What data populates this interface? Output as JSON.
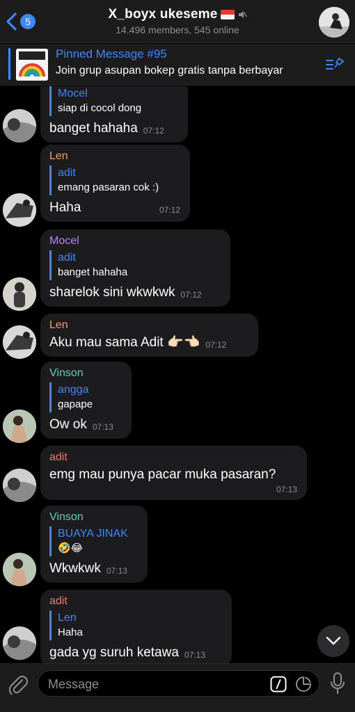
{
  "header": {
    "back_badge": "5",
    "title": "X_boyx ukeseme",
    "subtitle": "14.496 members, 545 online"
  },
  "pinned": {
    "title": "Pinned Message #95",
    "text": "Join grup asupan bokep gratis tanpa berbayar"
  },
  "messages": [
    {
      "sender": "",
      "reply_name": "Mocel",
      "reply_text": "siap di cocol dong",
      "text": "banget hahaha",
      "time": "07:12"
    },
    {
      "sender": "Len",
      "reply_name": "adit",
      "reply_text": "emang pasaran cok :)",
      "text": "Haha",
      "time": "07:12"
    },
    {
      "sender": "Mocel",
      "reply_name": "adit",
      "reply_text": "banget hahaha",
      "text": "sharelok sini wkwkwk",
      "time": "07:12"
    },
    {
      "sender": "Len",
      "text": "Aku mau sama Adit 👉🏻👈🏻",
      "time": "07:12"
    },
    {
      "sender": "Vinson",
      "reply_name": "angga",
      "reply_text": "gapape",
      "text": "Ow ok",
      "time": "07:13"
    },
    {
      "sender": "adit",
      "text": "emg mau punya pacar muka pasaran?",
      "time": "07:13"
    },
    {
      "sender": "Vinson",
      "reply_name": "BUAYA JINAK",
      "reply_text": "🤣😂",
      "text": "Wkwkwk",
      "time": "07:13"
    },
    {
      "sender": "adit",
      "reply_name": "Len",
      "reply_text": "Haha",
      "text": "gada yg suruh ketawa",
      "time": "07:13"
    }
  ],
  "input": {
    "placeholder": "Message"
  },
  "colors": {
    "accent": "#3e88f7",
    "bubble": "#1c1c1e",
    "background": "#000000"
  },
  "icons": [
    "chevron-left-icon",
    "mute-icon",
    "pin-list-icon",
    "chevron-down-icon",
    "paperclip-icon",
    "command-icon",
    "sticker-icon",
    "microphone-icon"
  ]
}
